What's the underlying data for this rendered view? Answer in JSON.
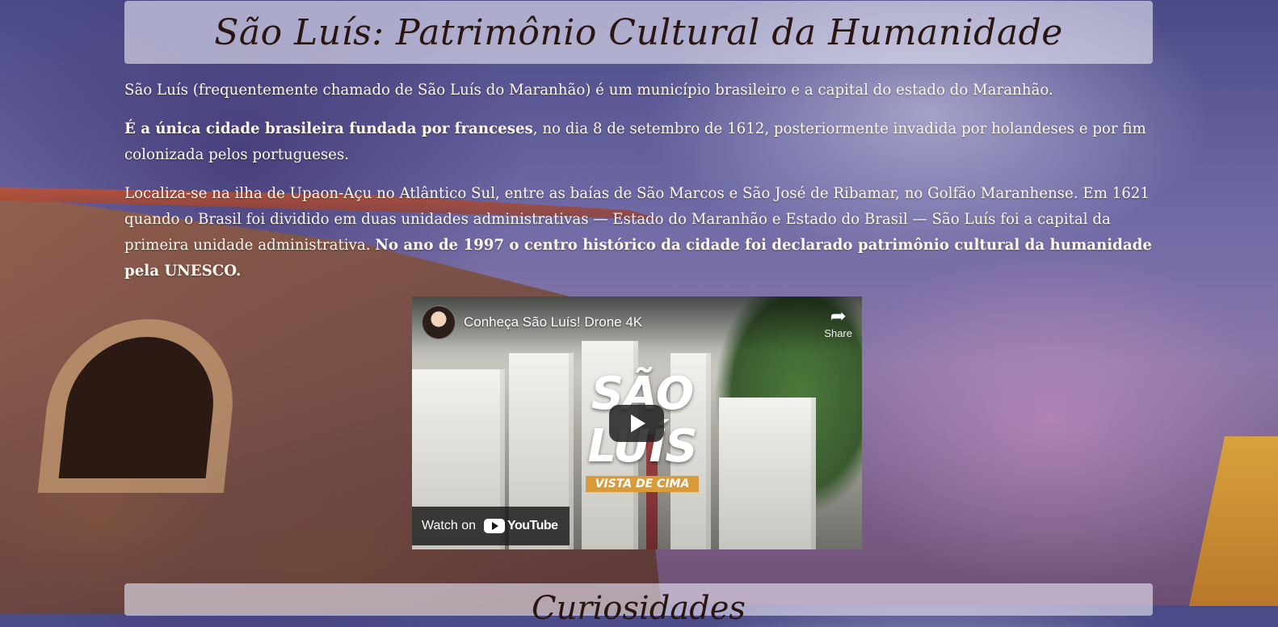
{
  "page": {
    "title": "São Luís: Patrimônio Cultural da Humanidade",
    "paragraphs": {
      "p1": "São Luís (frequentemente chamado de São Luís do Maranhão) é um município brasileiro e a capital do estado do Maranhão.",
      "p2_bold": "É a única cidade brasileira fundada por franceses",
      "p2_rest": ", no dia 8 de setembro de 1612, posteriormente invadida por holandeses e por fim colonizada pelos portugueses.",
      "p3_rest": "Localiza-se na ilha de Upaon-Açu no Atlântico Sul, entre as baías de São Marcos e São José de Ribamar, no Golfão Maranhense. Em 1621 quando o Brasil foi dividido em duas unidades administrativas — Estado do Maranhão e Estado do Brasil — São Luís foi a capital da primeira unidade administrativa. ",
      "p3_bold": "No ano de 1997 o centro histórico da cidade foi declarado patrimônio cultural da humanidade pela UNESCO."
    },
    "next_section_title": "Curiosidades"
  },
  "video": {
    "title": "Conheça São Luís! Drone 4K",
    "share_label": "Share",
    "overlay_title": "SÃO LUÍS",
    "overlay_tag": "VISTA DE CIMA",
    "watch_on_label": "Watch on",
    "youtube_label": "YouTube",
    "icons": {
      "share": "share-icon",
      "play": "play-icon",
      "youtube": "youtube-logo-icon"
    }
  },
  "colors": {
    "title_text": "#2a1512",
    "body_text": "#fff7ef",
    "tag_bg": "#d99a3a"
  }
}
